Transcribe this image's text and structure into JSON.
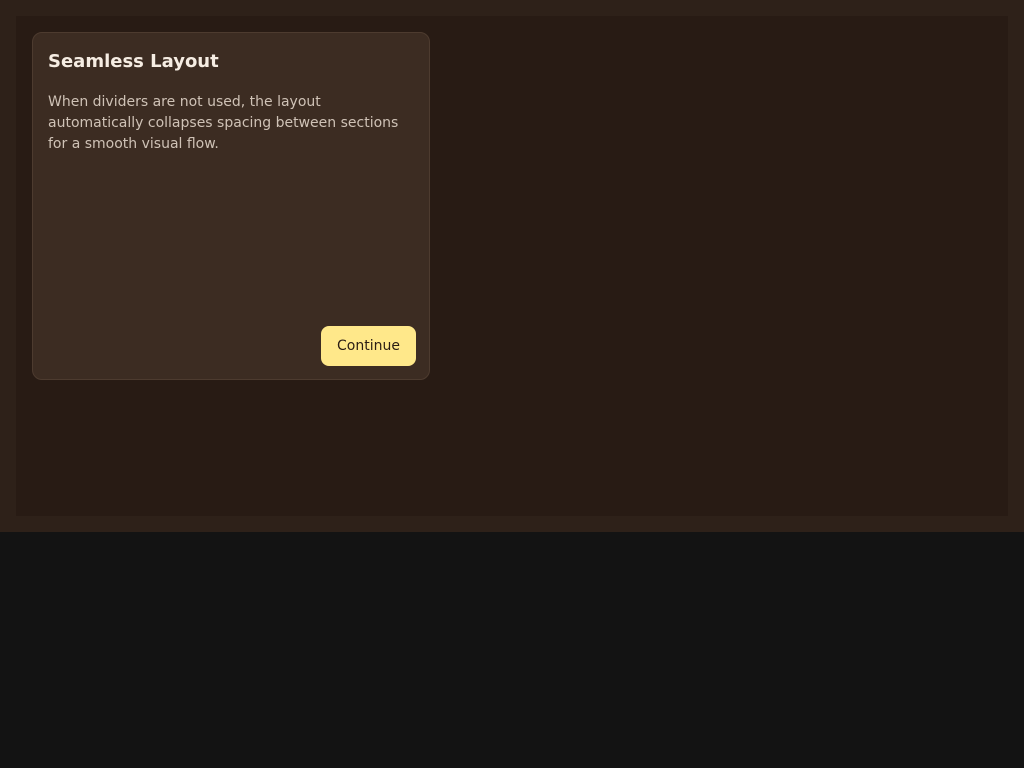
{
  "card": {
    "title": "Seamless Layout",
    "body": "When dividers are not used, the layout automatically collapses spacing between sections for a smooth visual flow.",
    "continue_label": "Continue"
  },
  "colors": {
    "page_background": "#131313",
    "frame": "#2e2119",
    "panel": "#281b14",
    "card": "#3c2c22",
    "accent_button": "#ffe88a"
  }
}
